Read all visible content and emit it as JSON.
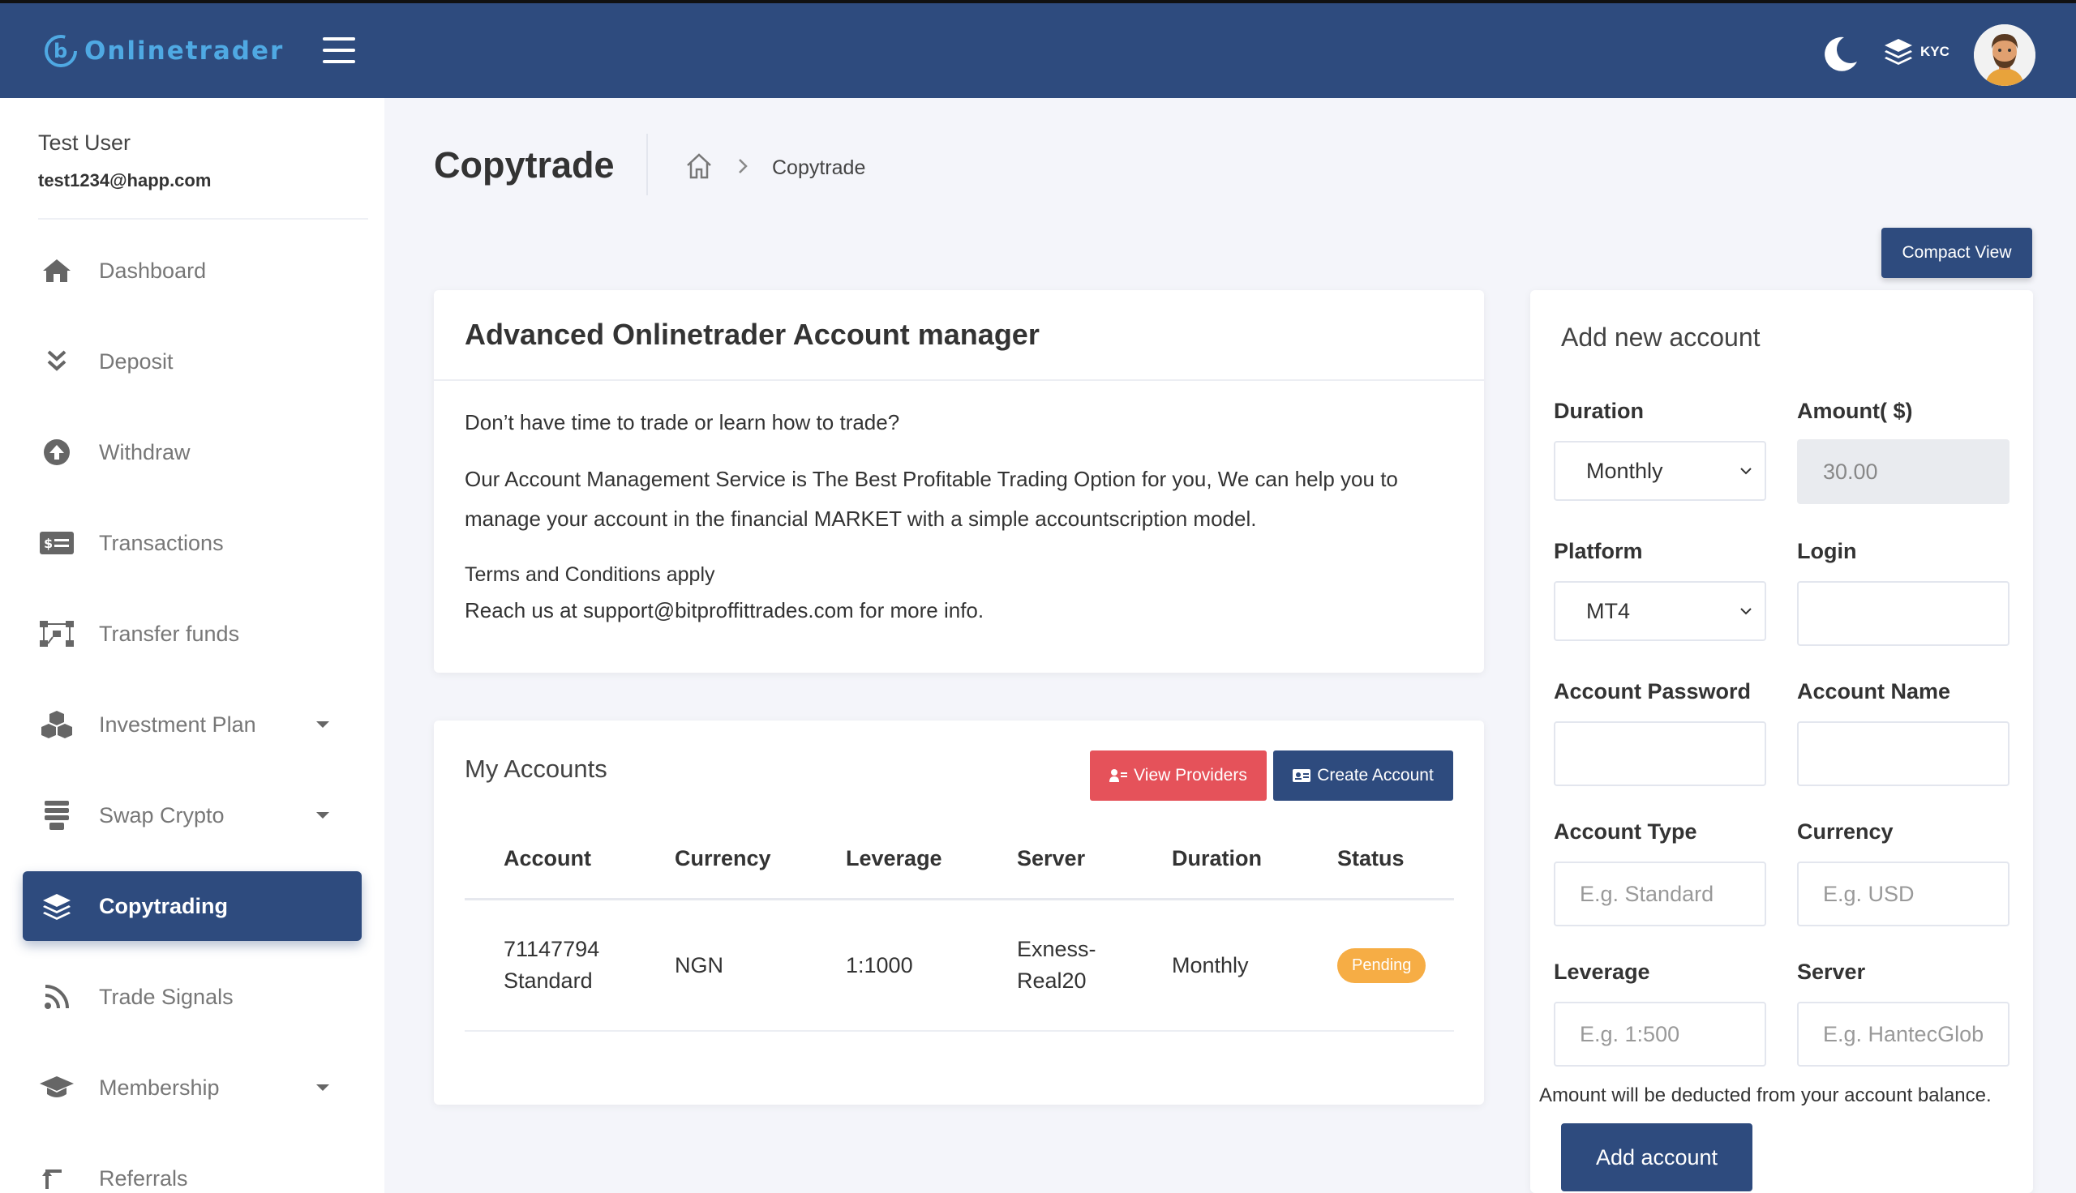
{
  "app": {
    "brand": "Onlinetrader",
    "kyc_label": "KYC"
  },
  "user": {
    "name": "Test User",
    "email": "test1234@happ.com"
  },
  "sidebar": {
    "items": [
      {
        "label": "Dashboard",
        "icon": "home-icon"
      },
      {
        "label": "Deposit",
        "icon": "double-chevron-down-icon"
      },
      {
        "label": "Withdraw",
        "icon": "arrow-up-circle-icon"
      },
      {
        "label": "Transactions",
        "icon": "money-bill-icon"
      },
      {
        "label": "Transfer funds",
        "icon": "network-icon"
      },
      {
        "label": "Investment Plan",
        "icon": "cubes-icon"
      },
      {
        "label": "Swap Crypto",
        "icon": "stack-icon"
      },
      {
        "label": "Copytrading",
        "icon": "layers-icon"
      },
      {
        "label": "Trade Signals",
        "icon": "rss-icon"
      },
      {
        "label": "Membership",
        "icon": "graduation-cap-icon"
      },
      {
        "label": "Referrals",
        "icon": "retweet-icon"
      }
    ]
  },
  "header": {
    "title": "Copytrade",
    "breadcrumb_current": "Copytrade",
    "compact_view": "Compact View"
  },
  "manager": {
    "title": "Advanced Onlinetrader Account manager",
    "question": "Don’t have time to trade or learn how to trade?",
    "paragraph": "Our Account Management Service is The Best Profitable Trading Option for you, We can help you to manage your account in the financial MARKET with a simple accountscription model.",
    "terms": "Terms and Conditions apply",
    "reach": "Reach us at support@bitproffittrades.com for more info."
  },
  "accounts": {
    "title": "My Accounts",
    "view_providers": "View Providers",
    "create_account": "Create Account",
    "columns": [
      "Account",
      "Currency",
      "Leverage",
      "Server",
      "Duration",
      "Status"
    ],
    "rows": [
      {
        "account_line1": "71147794",
        "account_line2": "Standard",
        "currency": "NGN",
        "leverage": "1:1000",
        "server_line1": "Exness-",
        "server_line2": "Real20",
        "duration": "Monthly",
        "status": "Pending"
      }
    ]
  },
  "form": {
    "title": "Add new account",
    "duration_label": "Duration",
    "duration_value": "Monthly",
    "amount_label": "Amount( $)",
    "amount_value": "30.00",
    "platform_label": "Platform",
    "platform_value": "MT4",
    "login_label": "Login",
    "password_label": "Account Password",
    "name_label": "Account Name",
    "type_label": "Account Type",
    "type_placeholder": "E.g. Standard",
    "currency_label": "Currency",
    "currency_placeholder": "E.g. USD",
    "leverage_label": "Leverage",
    "leverage_placeholder": "E.g. 1:500",
    "server_label": "Server",
    "server_placeholder": "E.g. HantecGlobal-live",
    "note": "Amount will be deducted from your account balance.",
    "submit": "Add account"
  },
  "colors": {
    "primary": "#2e4b7e",
    "danger": "#e5525a",
    "warning": "#f6ad45",
    "brand_text": "#4fa9e3"
  }
}
